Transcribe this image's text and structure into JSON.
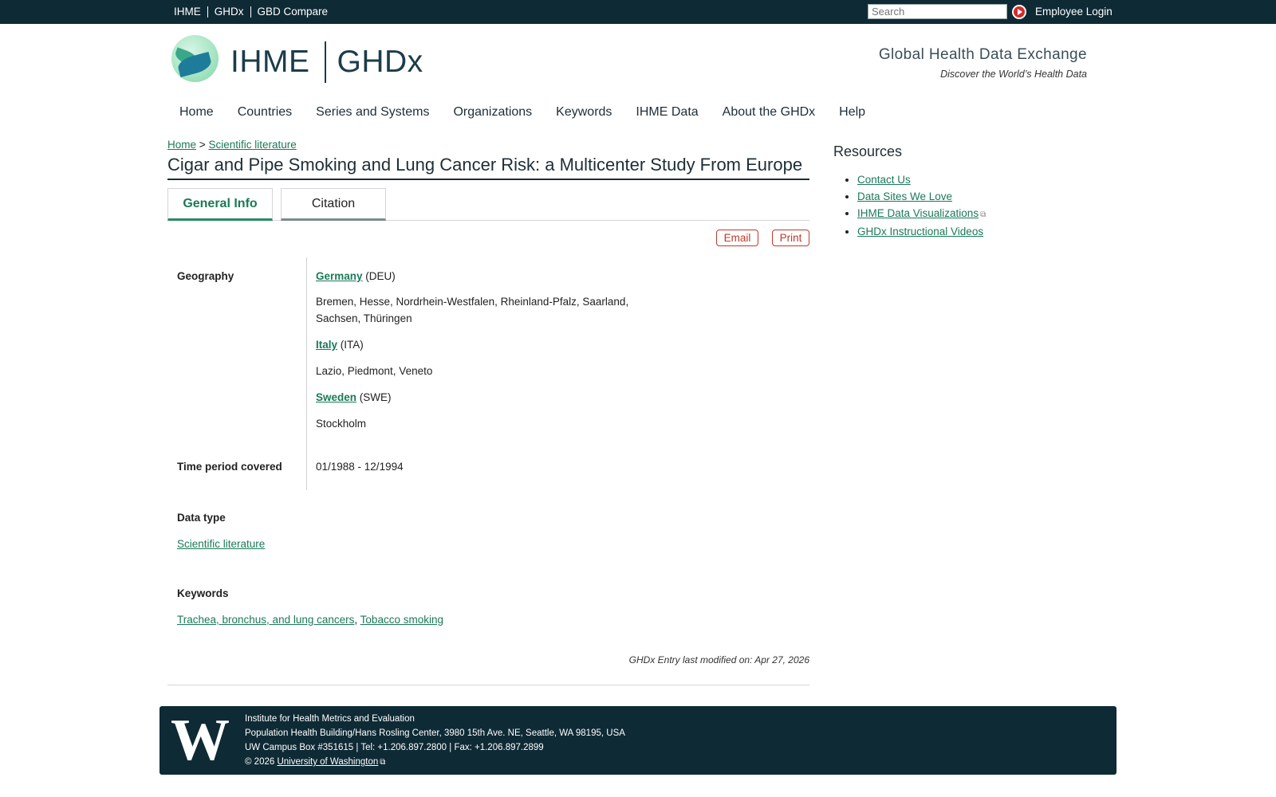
{
  "topbar": {
    "links": [
      "IHME",
      "GHDx",
      "GBD Compare"
    ],
    "search_placeholder": "Search",
    "login": "Employee Login"
  },
  "header": {
    "logo_ihme": "IHME",
    "logo_ghdx": "GHDx",
    "tagline": "Global Health Data Exchange",
    "subtagline": "Discover the World’s Health Data"
  },
  "nav": [
    "Home",
    "Countries",
    "Series and Systems",
    "Organizations",
    "Keywords",
    "IHME Data",
    "About the GHDx",
    "Help"
  ],
  "breadcrumb": {
    "home": "Home",
    "sep": ">",
    "current": "Scientific literature"
  },
  "page_title": "Cigar and Pipe Smoking and Lung Cancer Risk: a Multicenter Study From Europe",
  "tabs": {
    "general": "General Info",
    "citation": "Citation"
  },
  "actions": {
    "email": "Email",
    "print": "Print"
  },
  "geography": {
    "label": "Geography",
    "entries": [
      {
        "country": "Germany",
        "code": "(DEU)",
        "regions_line1": "Bremen, Hesse, Nordrhein-Westfalen, Rheinland-Pfalz, Saarland,",
        "regions_line2": "Sachsen, Thüringen"
      },
      {
        "country": "Italy",
        "code": "(ITA)",
        "regions_line1": "Lazio, Piedmont, Veneto"
      },
      {
        "country": "Sweden",
        "code": "(SWE)",
        "regions_line1": "Stockholm"
      }
    ]
  },
  "time_period": {
    "label": "Time period covered",
    "value": "01/1988 - 12/1994"
  },
  "data_type": {
    "label": "Data type",
    "value": "Scientific literature"
  },
  "keywords": {
    "label": "Keywords",
    "items": [
      "Trachea, bronchus, and lung cancers",
      "Tobacco smoking"
    ],
    "sep": ","
  },
  "modified": "GHDx Entry last modified on: Apr 27, 2026",
  "sidebar": {
    "title": "Resources",
    "items": [
      "Contact Us",
      "Data Sites We Love",
      "IHME Data Visualizations",
      "GHDx Instructional Videos"
    ]
  },
  "footer": {
    "logo": "W",
    "line1": "Institute for Health Metrics and Evaluation",
    "line2": "Population Health Building/Hans Rosling Center, 3980 15th Ave. NE, Seattle, WA 98195, USA",
    "line3": "UW Campus Box #351615 | Tel: +1.206.897.2800 | Fax: +1.206.897.2899",
    "copyright": "© 2026",
    "uw_link": "University of Washington"
  },
  "colors": {
    "dark": "#0e2a35",
    "link": "#1a7a56",
    "accent_red": "#c0392b"
  }
}
